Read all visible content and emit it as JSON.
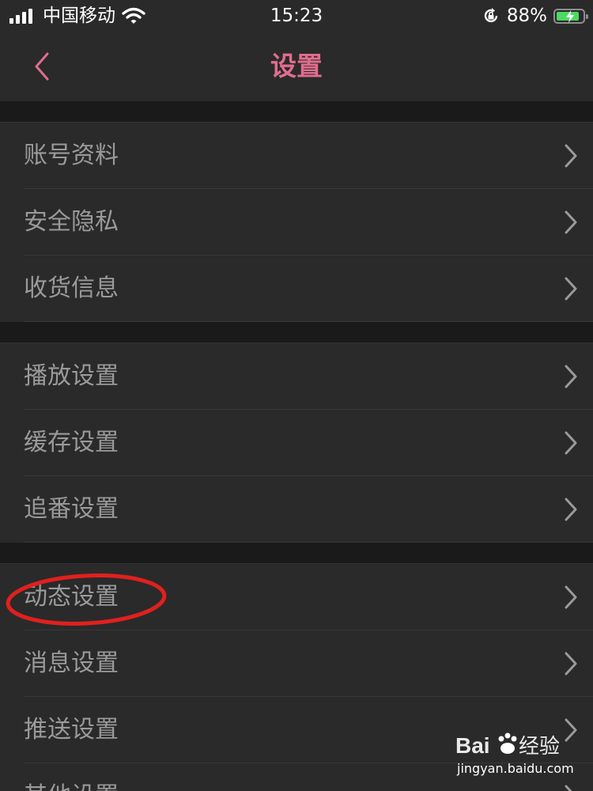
{
  "status_bar": {
    "carrier": "中国移动",
    "time": "15:23",
    "battery_percent": "88%",
    "battery_level": 0.88
  },
  "nav": {
    "title": "设置",
    "back_icon": "chevron-left-icon"
  },
  "groups": [
    {
      "items": [
        {
          "label": "账号资料"
        },
        {
          "label": "安全隐私"
        },
        {
          "label": "收货信息"
        }
      ]
    },
    {
      "items": [
        {
          "label": "播放设置"
        },
        {
          "label": "缓存设置"
        },
        {
          "label": "追番设置"
        }
      ]
    },
    {
      "items": [
        {
          "label": "动态设置"
        },
        {
          "label": "消息设置"
        },
        {
          "label": "推送设置"
        },
        {
          "label": "其他设置"
        }
      ]
    }
  ],
  "watermark": {
    "brand": "Bai经验",
    "url": "jingyan.baidu.com"
  },
  "colors": {
    "accent": "#e06d8f",
    "background": "#2a2a2a",
    "annotation": "#e0201e"
  }
}
